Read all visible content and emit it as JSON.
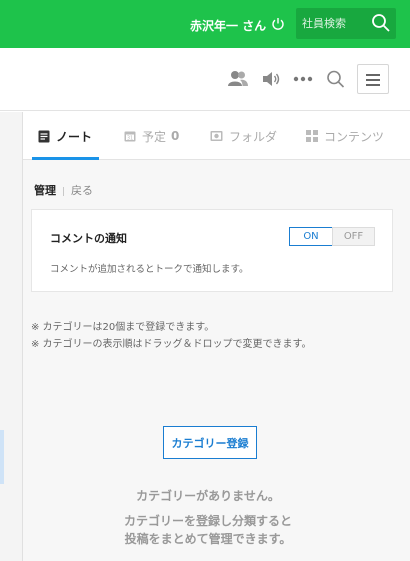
{
  "header": {
    "user_name": "赤沢年一 さん",
    "search_placeholder": "社員検索"
  },
  "toolbar": {
    "icons": [
      "group-icon",
      "speaker-icon",
      "more-icon",
      "search-icon",
      "menu-icon"
    ]
  },
  "tabs": [
    {
      "label": "ノート",
      "icon": "note-icon",
      "active": true
    },
    {
      "label": "予定",
      "count": "0",
      "icon": "calendar-icon"
    },
    {
      "label": "フォルダ",
      "icon": "folder-icon"
    },
    {
      "label": "コンテンツ",
      "icon": "grid-icon"
    }
  ],
  "sub_nav": {
    "manage": "管理",
    "back": "戻る"
  },
  "notification": {
    "title": "コメントの通知",
    "description": "コメントが追加されるとトークで通知します。",
    "on_label": "ON",
    "off_label": "OFF",
    "state": "ON"
  },
  "notes": [
    "※ カテゴリーは20個まで登録できます。",
    "※ カテゴリーの表示順はドラッグ＆ドロップで変更できます。"
  ],
  "register_button": "カテゴリー登録",
  "empty_state": {
    "title": "カテゴリーがありません。",
    "line1": "カテゴリーを登録し分類すると",
    "line2": "投稿をまとめて管理できます。"
  },
  "colors": {
    "brand_green": "#1ec34b",
    "accent_blue": "#1a7dd1"
  }
}
